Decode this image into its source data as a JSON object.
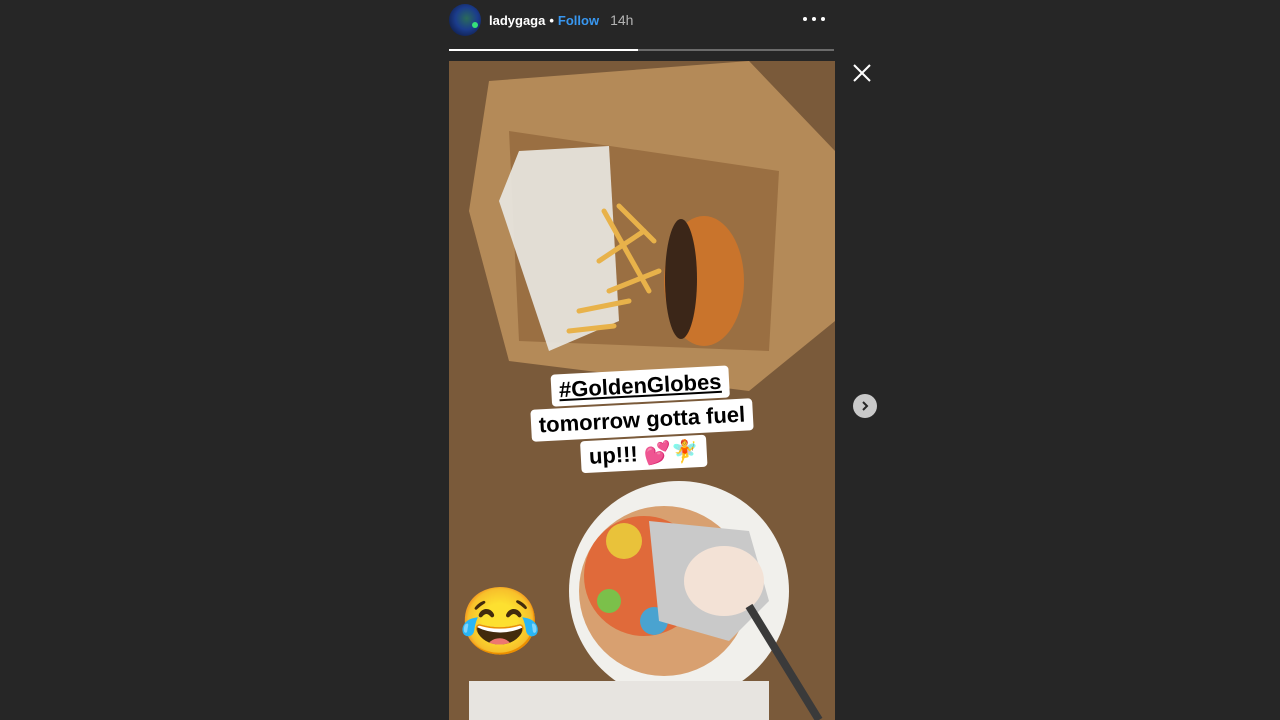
{
  "story": {
    "username": "ladygaga",
    "separator": "•",
    "follow_label": "Follow",
    "time_ago": "14h",
    "progress_fraction": 0.49
  },
  "caption": {
    "hashtag": "#GoldenGlobes",
    "line2": "tomorrow gotta fuel",
    "line3": "up!!! 💕🧚"
  },
  "emoji_sticker": "😂",
  "icons": {
    "more": "more-options-icon",
    "close": "close-icon",
    "next": "chevron-right-icon"
  }
}
